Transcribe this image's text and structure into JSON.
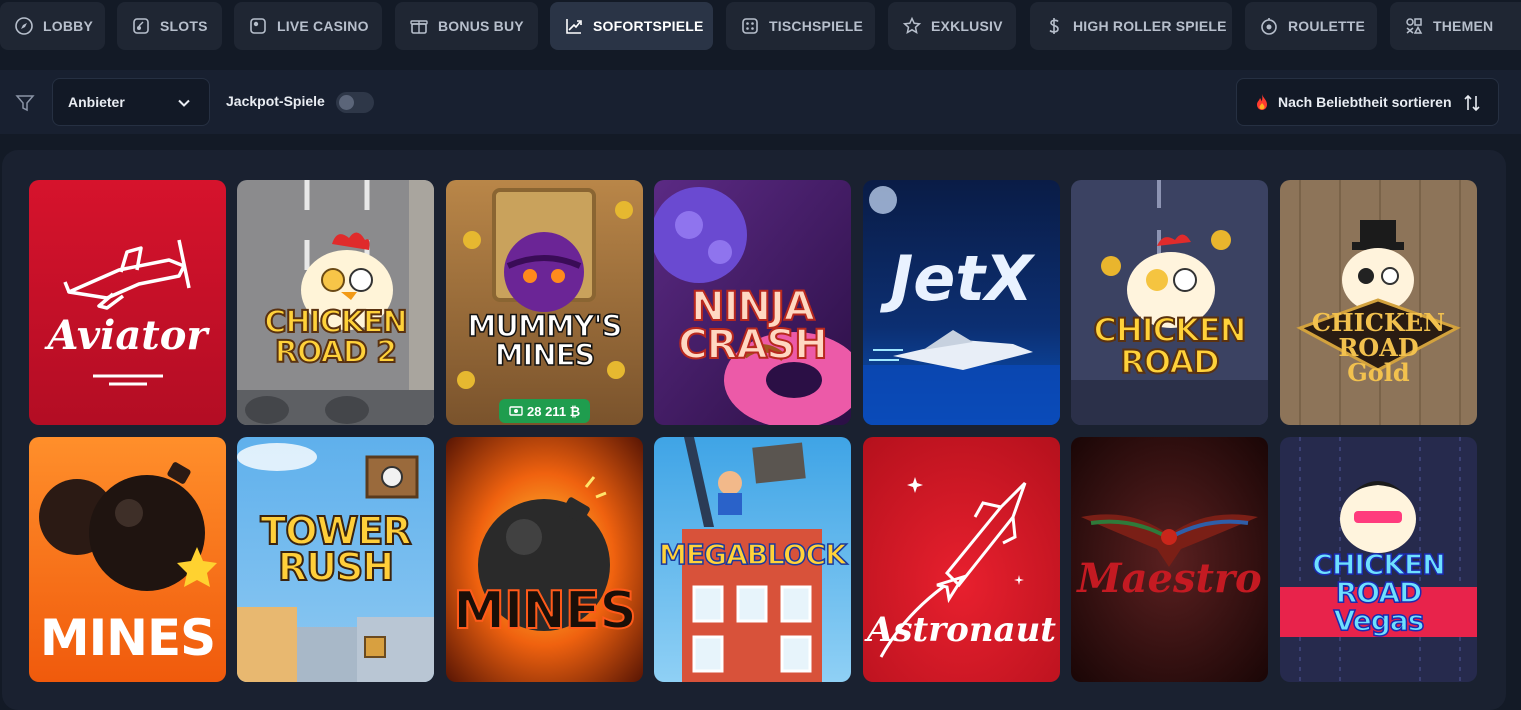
{
  "tabs": [
    {
      "label": "LOBBY",
      "icon": "compass-icon",
      "active": false
    },
    {
      "label": "SLOTS",
      "icon": "cherry-icon",
      "active": false
    },
    {
      "label": "LIVE CASINO",
      "icon": "live-icon",
      "active": false
    },
    {
      "label": "BONUS BUY",
      "icon": "gift-icon",
      "active": false
    },
    {
      "label": "SOFORTSPIELE",
      "icon": "trend-icon",
      "active": true
    },
    {
      "label": "TISCHSPIELE",
      "icon": "dice-icon",
      "active": false
    },
    {
      "label": "EXKLUSIV",
      "icon": "star-icon",
      "active": false
    },
    {
      "label": "HIGH ROLLER SPIELE",
      "icon": "dollar-icon",
      "active": false
    },
    {
      "label": "ROULETTE",
      "icon": "roulette-icon",
      "active": false
    },
    {
      "label": "THEMEN",
      "icon": "themes-icon",
      "active": false
    }
  ],
  "filters": {
    "provider_label": "Anbieter",
    "jackpot_label": "Jackpot-Spiele",
    "jackpot_enabled": false,
    "sort_label": "Nach Beliebtheit sortieren"
  },
  "games": [
    {
      "title": "Aviator",
      "colors": [
        "#d0102a",
        "#a50b22"
      ]
    },
    {
      "title": "CHICKEN ROAD 2",
      "colors": [
        "#8e8e8e",
        "#5c5d60"
      ]
    },
    {
      "title": "MUMMY'S MINES",
      "colors": [
        "#a0703b",
        "#6a4524"
      ],
      "badge": "28 211 ₿"
    },
    {
      "title": "NINJA CRASH",
      "colors": [
        "#4a1f6b",
        "#2d1040"
      ]
    },
    {
      "title": "JetX",
      "colors": [
        "#0b2a66",
        "#081634"
      ]
    },
    {
      "title": "CHICKEN ROAD",
      "colors": [
        "#3d4463",
        "#272c43"
      ]
    },
    {
      "title": "CHICKEN ROAD Gold",
      "colors": [
        "#8c7358",
        "#6a5640"
      ]
    },
    {
      "title": "MINES",
      "colors": [
        "#ff7a1a",
        "#e4550a"
      ]
    },
    {
      "title": "TOWER RUSH",
      "colors": [
        "#5aa6e6",
        "#2f72b8"
      ]
    },
    {
      "title": "MINES",
      "colors": [
        "#d9480f",
        "#6b1d05"
      ]
    },
    {
      "title": "MEGABLOCK",
      "colors": [
        "#4fb0e8",
        "#c54b2a"
      ]
    },
    {
      "title": "Astronaut",
      "colors": [
        "#e01d2c",
        "#a3101c"
      ]
    },
    {
      "title": "Maestro",
      "colors": [
        "#3b1414",
        "#1c0707"
      ]
    },
    {
      "title": "CHICKEN ROAD Vegas",
      "colors": [
        "#2b2f55",
        "#171a36"
      ]
    }
  ]
}
